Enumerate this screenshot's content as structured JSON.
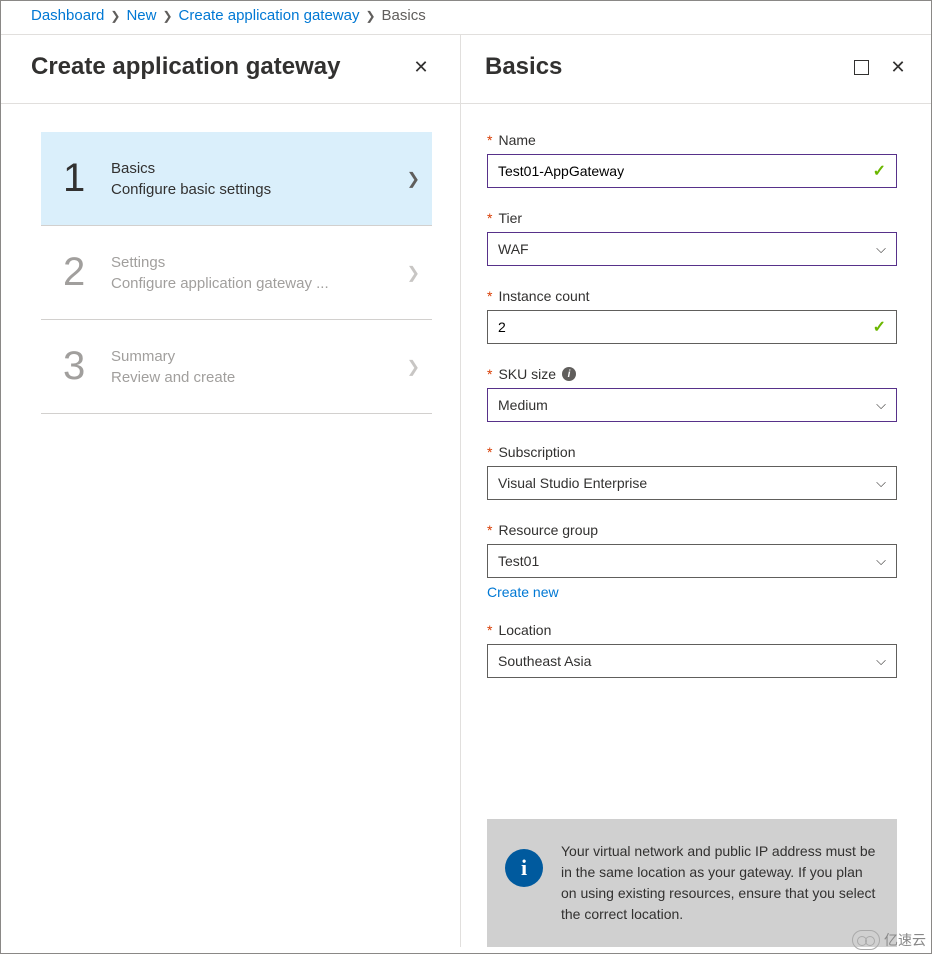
{
  "breadcrumb": {
    "items": [
      {
        "label": "Dashboard",
        "link": true
      },
      {
        "label": "New",
        "link": true
      },
      {
        "label": "Create application gateway",
        "link": true
      },
      {
        "label": "Basics",
        "link": false
      }
    ]
  },
  "left": {
    "title": "Create application gateway",
    "steps": [
      {
        "num": "1",
        "title": "Basics",
        "subtitle": "Configure basic settings",
        "active": true
      },
      {
        "num": "2",
        "title": "Settings",
        "subtitle": "Configure application gateway ...",
        "active": false
      },
      {
        "num": "3",
        "title": "Summary",
        "subtitle": "Review and create",
        "active": false
      }
    ]
  },
  "right": {
    "title": "Basics",
    "fields": {
      "name": {
        "label": "Name",
        "value": "Test01-AppGateway",
        "required": true,
        "validated": true,
        "type": "text"
      },
      "tier": {
        "label": "Tier",
        "value": "WAF",
        "required": true,
        "validated": true,
        "type": "select"
      },
      "instance_count": {
        "label": "Instance count",
        "value": "2",
        "required": true,
        "validated": true,
        "type": "text"
      },
      "sku_size": {
        "label": "SKU size",
        "value": "Medium",
        "required": true,
        "validated": true,
        "type": "select",
        "info": true
      },
      "subscription": {
        "label": "Subscription",
        "value": "Visual Studio Enterprise",
        "required": true,
        "validated": false,
        "type": "select"
      },
      "resource_group": {
        "label": "Resource group",
        "value": "Test01",
        "required": true,
        "validated": false,
        "type": "select",
        "link": "Create new"
      },
      "location": {
        "label": "Location",
        "value": "Southeast Asia",
        "required": true,
        "validated": false,
        "type": "select"
      }
    },
    "info_message": "Your virtual network and public IP address must be in the same location as your gateway. If you plan on using existing resources, ensure that you select the correct location."
  },
  "watermark": "亿速云"
}
